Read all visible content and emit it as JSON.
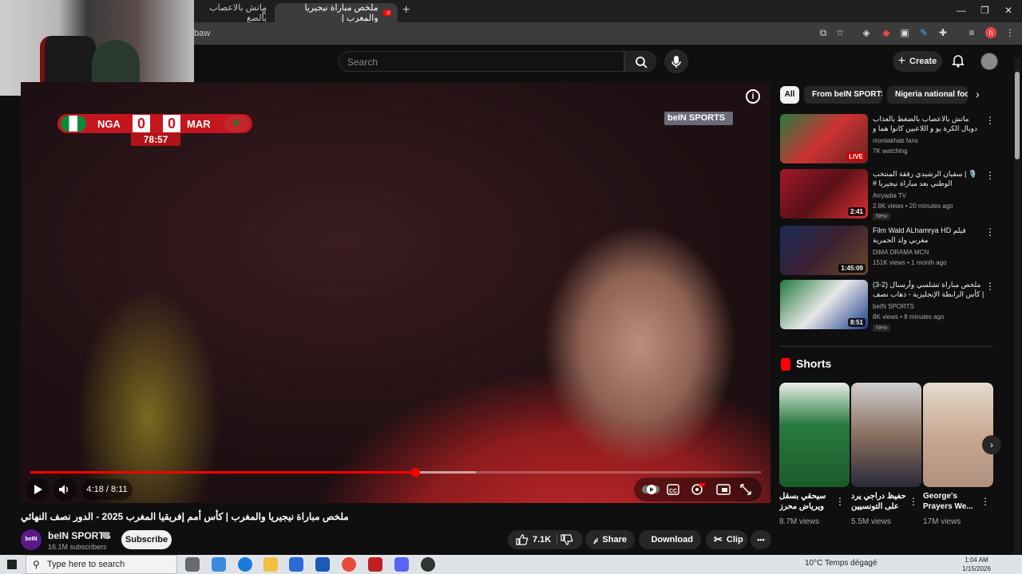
{
  "browser": {
    "tabs": [
      {
        "title": "ماتش بالاعصاب بالضغ",
        "active": false
      },
      {
        "title": "ملخص مباراة نيجيريا والمغرب |",
        "active": true
      }
    ],
    "url_fragment": "baw",
    "win_min": "—",
    "win_restore": "❐",
    "win_close": "✕",
    "tab_close": "×",
    "new_tab": "+"
  },
  "header": {
    "search_placeholder": "Search",
    "create_label": "Create",
    "create_icon": "+"
  },
  "player": {
    "score": {
      "home": "NGA",
      "away": "MAR",
      "home_score": "0",
      "away_score": "0",
      "clock": "78:57"
    },
    "broadcaster": "beIN SPORTS",
    "time_display": "4:18 / 8:11",
    "progress_fraction": 0.527,
    "buffer_fraction": 0.61,
    "info_label": "i"
  },
  "video": {
    "title": "ملخص مباراة نيجيريا والمغرب | كأس أمم إفريقيا المغرب 2025 - الدور نصف النهائي",
    "channel": "beIN SPORTS",
    "channel_avatar_text": "beIN",
    "subscribers": "16.1M subscribers",
    "subscribe_label": "Subscribe",
    "likes": "7.1K",
    "share_label": "Share",
    "download_label": "Download",
    "clip_label": "Clip",
    "more": "•••"
  },
  "chips": [
    "All",
    "From beIN SPORTS",
    "Nigeria national foot"
  ],
  "recommendations": [
    {
      "title": "ماتش بالاعصاب بالضغط بالعذاب دوبال الكرة يو و اللاعبين كانوا هما و رجال",
      "channel": "montakhab fans",
      "meta": "7K watching",
      "badge": "LIVE",
      "new": false
    },
    {
      "title": "🎙️ | سفيان الرشيدي رفقة المنتخب الوطني بعد مباراة نيجيريا # وليد_الركراكي",
      "channel": "Arryadia TV",
      "meta": "2.8K views • 20 minutes ago",
      "badge": "2:41",
      "new": true
    },
    {
      "title": "Film Wald ALhamrya HD فيلم مغربي ولد الحمرية",
      "channel": "DiMA DRAMA MCN",
      "meta": "151K views • 1 month ago",
      "badge": "1:45:09",
      "new": false
    },
    {
      "title": "ملخص مباراة تشلسي وأرسنال (2-3) | كأس الرابطة الإنجليزية - ذهاب نصف النهائي",
      "channel": "beIN SPORTS",
      "meta": "8K views • 8 minutes ago",
      "badge": "8:51",
      "new": true
    }
  ],
  "new_badge": "New",
  "shorts": {
    "header": "Shorts",
    "items": [
      {
        "title": "سيحقي بسقل ويرياض محرز ف...",
        "views": "8.7M views"
      },
      {
        "title": "حفيظ دراجي يرد على التونسيين",
        "views": "5.5M views"
      },
      {
        "title": "George's Prayers We...",
        "views": "17M views"
      }
    ]
  },
  "taskbar": {
    "search_placeholder": "Type here to search",
    "weather": "10°C  Temps dégagé",
    "time": "1:04 AM",
    "date": "1/15/2026"
  },
  "colors": {
    "accent": "#ff0000",
    "bg": "#0f0f0f",
    "chip": "#272727"
  }
}
